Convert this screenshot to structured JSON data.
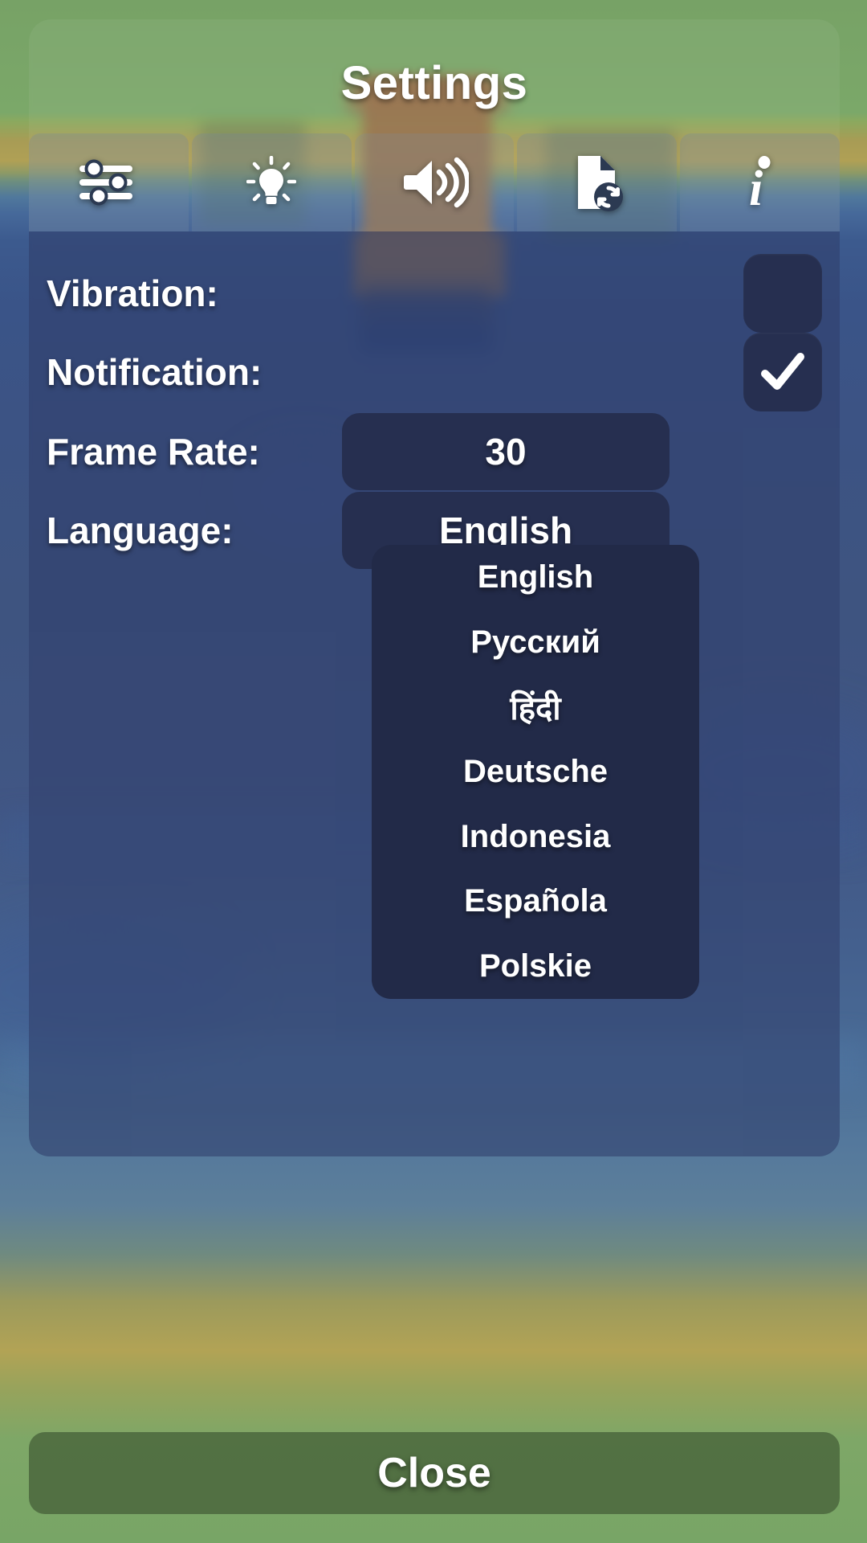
{
  "header": {
    "title": "Settings"
  },
  "tabs": [
    {
      "id": "general",
      "icon": "sliders-icon",
      "label": "General",
      "active": false
    },
    {
      "id": "graphics",
      "icon": "lightbulb-icon",
      "label": "Graphics",
      "active": false
    },
    {
      "id": "sound",
      "icon": "speaker-icon",
      "label": "Sound",
      "active": true
    },
    {
      "id": "data",
      "icon": "file-sync-icon",
      "label": "Data",
      "active": false
    },
    {
      "id": "about",
      "icon": "info-icon",
      "label": "About",
      "active": false
    }
  ],
  "settings": {
    "vibration": {
      "label": "Vibration:",
      "control": "checkbox",
      "checked": false
    },
    "notification": {
      "label": "Notification:",
      "control": "checkbox",
      "checked": true
    },
    "frame_rate": {
      "label": "Frame Rate:",
      "control": "value",
      "value": "30"
    },
    "language": {
      "label": "Language:",
      "control": "dropdown",
      "value": "English",
      "expanded": true,
      "options": [
        "English",
        "Русский",
        "हिंदी",
        "Deutsche",
        "Indonesia",
        "Española",
        "Polskie"
      ]
    }
  },
  "footer": {
    "close_label": "Close"
  },
  "colors": {
    "panel_body": "#2a3868",
    "control_fill": "#262f50",
    "dropdown_fill": "#222a48",
    "close_button": "#46623a",
    "text": "#ffffff"
  }
}
